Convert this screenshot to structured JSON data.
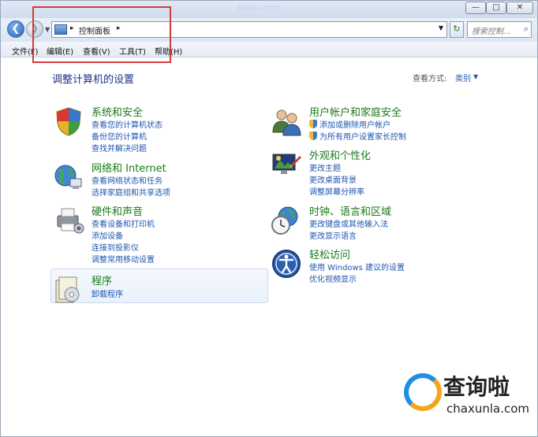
{
  "window": {
    "faded_title": "baidu.com",
    "min": "—",
    "max": "□",
    "close": "✕"
  },
  "nav": {
    "back": "❮",
    "forward": "❯",
    "dropdown": "▼",
    "breadcrumb_sep": "▸",
    "breadcrumb": "控制面板",
    "address_dropdown": "▼",
    "refresh": "↻",
    "search_placeholder": "搜索控制...",
    "search_icon": "⌕"
  },
  "menu": [
    "文件(F)",
    "编辑(E)",
    "查看(V)",
    "工具(T)",
    "帮助(H)"
  ],
  "page": {
    "title": "调整计算机的设置",
    "view_by_label": "查看方式:",
    "view_by_value": "类别",
    "view_by_dropdown": "▼"
  },
  "categories": {
    "system": {
      "title": "系统和安全",
      "icon": "shield-icon",
      "links": [
        "查看您的计算机状态",
        "备份您的计算机",
        "查找并解决问题"
      ]
    },
    "network": {
      "title": "网络和 Internet",
      "icon": "globe-network-icon",
      "links": [
        "查看网络状态和任务",
        "选择家庭组和共享选项"
      ]
    },
    "hardware": {
      "title": "硬件和声音",
      "icon": "printer-icon",
      "links": [
        "查看设备和打印机",
        "添加设备",
        "连接到投影仪",
        "调整常用移动设置"
      ]
    },
    "programs": {
      "title": "程序",
      "icon": "programs-icon",
      "links": [
        "卸载程序"
      ]
    },
    "users": {
      "title": "用户帐户和家庭安全",
      "icon": "users-icon",
      "links": [
        "添加或删除用户帐户",
        "为所有用户设置家长控制"
      ]
    },
    "appearance": {
      "title": "外观和个性化",
      "icon": "monitor-icon",
      "links": [
        "更改主题",
        "更改桌面背景",
        "调整屏幕分辨率"
      ]
    },
    "clock": {
      "title": "时钟、语言和区域",
      "icon": "clock-globe-icon",
      "links": [
        "更改键盘或其他输入法",
        "更改显示语言"
      ]
    },
    "ease": {
      "title": "轻松访问",
      "icon": "accessibility-icon",
      "links": [
        "使用 Windows 建议的设置",
        "优化视频显示"
      ]
    }
  },
  "watermark": {
    "text": "查询啦",
    "url": "chaxunla.com"
  },
  "colors": {
    "category_title": "#1a7a1a",
    "link": "#1e56b0",
    "heading": "#1e3287",
    "highlight_box": "#d33a3a"
  }
}
